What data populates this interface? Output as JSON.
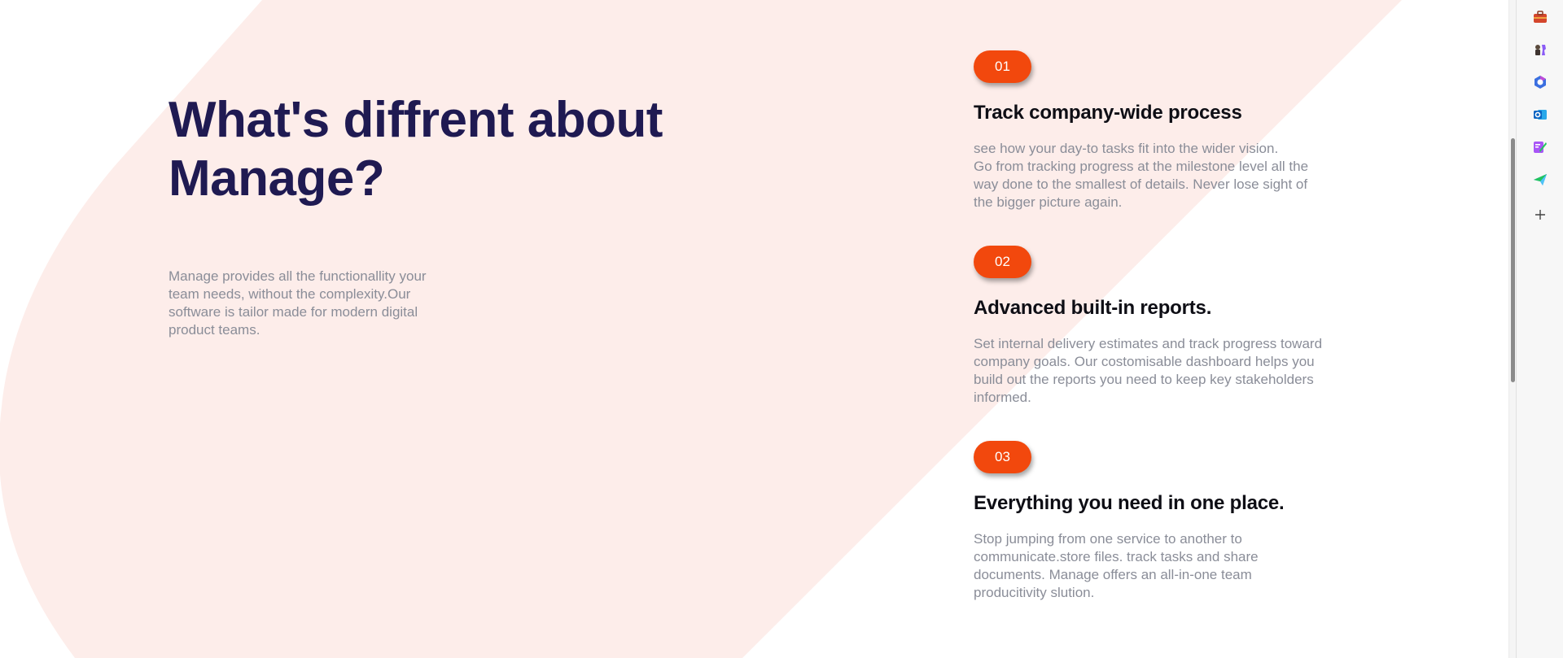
{
  "main": {
    "heading_line1": "What's diffrent about",
    "heading_line2": "Manage?",
    "intro_lines": [
      "Manage provides all the functionallity your",
      "team needs, without the complexity.Our",
      "software is tailor made for modern digital",
      "product teams."
    ]
  },
  "features": [
    {
      "number": "01",
      "title": "Track company-wide process",
      "desc_lines": [
        "see how your day-to tasks fit into the wider vision.",
        "Go from tracking progress at the milestone level all the",
        "way done to the smallest of details. Never lose sight of",
        "the bigger picture again."
      ]
    },
    {
      "number": "02",
      "title": "Advanced built-in reports.",
      "desc_lines": [
        "Set internal delivery estimates and track progress toward",
        "company goals. Our costomisable dashboard helps you",
        "build out the reports you need to keep key stakeholders",
        "informed."
      ]
    },
    {
      "number": "03",
      "title": "Everything you need in one place.",
      "desc_lines": [
        "Stop jumping from one service to another to",
        "communicate.store files. track tasks and share",
        "documents. Manage offers an all-in-one team",
        "producitivity slution."
      ]
    }
  ],
  "sidebar": {
    "icons": [
      "briefcase-icon",
      "chess-icon",
      "copilot-icon",
      "outlook-icon",
      "designer-icon",
      "send-icon",
      "add-icon"
    ]
  },
  "colors": {
    "accent": "#f2480d",
    "heading": "#1f1a52",
    "body_text": "#8a8d98",
    "blob": "#fdedea"
  }
}
